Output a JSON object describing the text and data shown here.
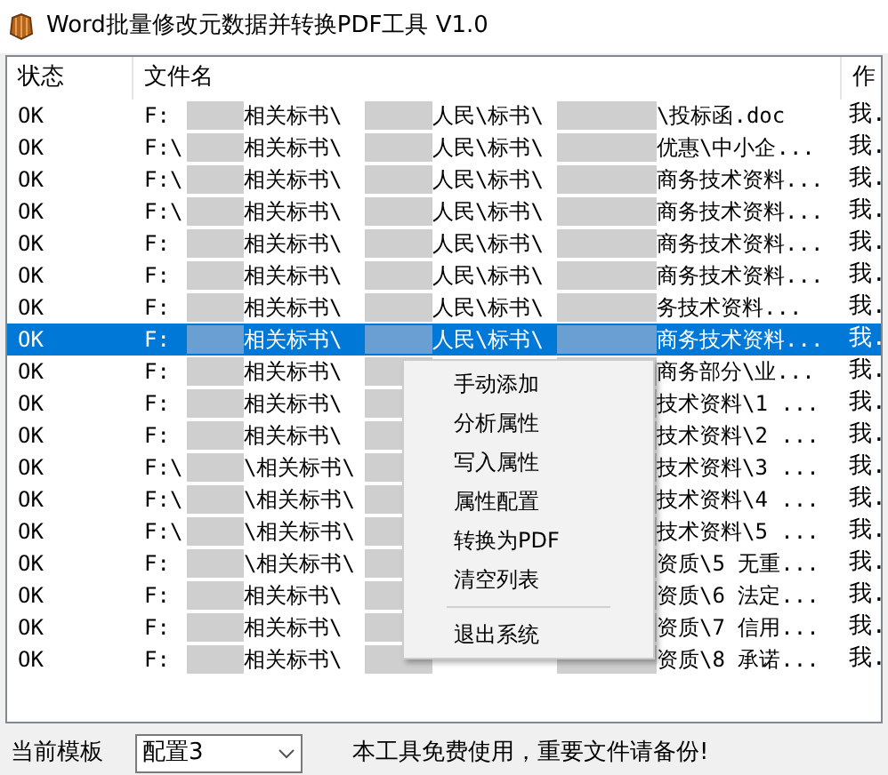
{
  "window": {
    "title": "Word批量修改元数据并转换PDF工具 V1.0"
  },
  "table": {
    "columns": [
      "状态",
      "文件名",
      "作"
    ],
    "rows": [
      {
        "status": "OK",
        "prefix": "F:",
        "part1": "相关标书\\",
        "part2": "人民\\标书\\",
        "tail": "\\投标函.doc",
        "author": "我.",
        "selected": false
      },
      {
        "status": "OK",
        "prefix": "F:\\",
        "part1": "相关标书\\",
        "part2": "人民\\标书\\",
        "tail": "优惠\\中小企...",
        "author": "我.",
        "selected": false
      },
      {
        "status": "OK",
        "prefix": "F:\\",
        "part1": "相关标书\\",
        "part2": "人民\\标书\\",
        "tail": "商务技术资料...",
        "author": "我.",
        "selected": false
      },
      {
        "status": "OK",
        "prefix": "F:\\",
        "part1": "相关标书\\",
        "part2": "人民\\标书\\",
        "tail": "商务技术资料...",
        "author": "我.",
        "selected": false
      },
      {
        "status": "OK",
        "prefix": "F:",
        "part1": "相关标书\\",
        "part2": "人民\\标书\\",
        "tail": "商务技术资料...",
        "author": "我.",
        "selected": false
      },
      {
        "status": "OK",
        "prefix": "F:",
        "part1": "相关标书\\",
        "part2": "人民\\标书\\",
        "tail": "商务技术资料...",
        "author": "我.",
        "selected": false
      },
      {
        "status": "OK",
        "prefix": "F:",
        "part1": "相关标书\\",
        "part2": "人民\\标书\\",
        "tail": "务技术资料...",
        "author": "我.",
        "selected": false
      },
      {
        "status": "OK",
        "prefix": "F:",
        "part1": "相关标书\\",
        "part2": "人民\\标书\\",
        "tail": "商务技术资料...",
        "author": "我.",
        "selected": true
      },
      {
        "status": "OK",
        "prefix": "F:",
        "part1": "相关标书\\",
        "tail": "商务部分\\业...",
        "author": "我.",
        "selected": false
      },
      {
        "status": "OK",
        "prefix": "F:",
        "part1": "相关标书\\",
        "tail": "技术资料\\1 ...",
        "author": "我.",
        "selected": false
      },
      {
        "status": "OK",
        "prefix": "F:",
        "part1": "相关标书\\",
        "tail": "技术资料\\2 ...",
        "author": "我.",
        "selected": false
      },
      {
        "status": "OK",
        "prefix": "F:\\",
        "part1": "\\相关标书\\",
        "tail": "技术资料\\3 ...",
        "author": "我.",
        "selected": false
      },
      {
        "status": "OK",
        "prefix": "F:\\",
        "part1": "\\相关标书\\",
        "tail": "技术资料\\4 ...",
        "author": "我.",
        "selected": false
      },
      {
        "status": "OK",
        "prefix": "F:\\",
        "part1": "\\相关标书\\",
        "tail": "技术资料\\5 ...",
        "author": "我.",
        "selected": false
      },
      {
        "status": "OK",
        "prefix": "F:",
        "part1": "\\相关标书\\",
        "tail": "资质\\5 无重...",
        "author": "我.",
        "selected": false
      },
      {
        "status": "OK",
        "prefix": "F:",
        "part1": "相关标书\\",
        "tail": "资质\\6 法定...",
        "author": "我.",
        "selected": false
      },
      {
        "status": "OK",
        "prefix": "F:",
        "part1": "相关标书\\",
        "tail": "资质\\7 信用...",
        "author": "我.",
        "selected": false
      },
      {
        "status": "OK",
        "prefix": "F:",
        "part1": "相关标书\\",
        "tail": "资质\\8  承诺...",
        "author": "我.",
        "selected": false
      }
    ]
  },
  "context_menu": {
    "items": [
      {
        "kind": "item",
        "label": "手动添加"
      },
      {
        "kind": "item",
        "label": "分析属性"
      },
      {
        "kind": "item",
        "label": "写入属性"
      },
      {
        "kind": "item",
        "label": "属性配置"
      },
      {
        "kind": "item",
        "label": "转换为PDF"
      },
      {
        "kind": "item",
        "label": "清空列表"
      },
      {
        "kind": "separator"
      },
      {
        "kind": "item",
        "label": "退出系统"
      }
    ]
  },
  "status_bar": {
    "template_label": "当前模板",
    "template_value": "配置3",
    "message": "本工具免费使用，重要文件请备份!"
  }
}
